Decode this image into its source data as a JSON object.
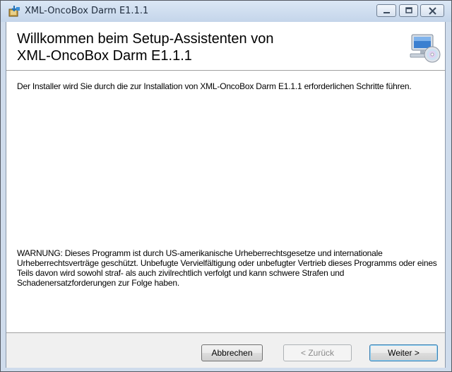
{
  "window": {
    "title": "XML-OncoBox Darm E1.1.1"
  },
  "header": {
    "title": "Willkommen beim Setup-Assistenten von\nXML-OncoBox Darm E1.1.1",
    "icon": "computer-cd-icon"
  },
  "body": {
    "intro": "Der Installer wird Sie durch die zur Installation von XML-OncoBox Darm E1.1.1 erforderlichen Schritte führen.",
    "warning": "WARNUNG: Dieses Programm ist durch US-amerikanische Urheberrechtsgesetze und internationale Urheberrechtsverträge geschützt. Unbefugte Vervielfältigung oder unbefugter Vertrieb dieses Programms oder eines Teils davon wird sowohl straf- als auch zivilrechtlich verfolgt und kann schwere Strafen und Schadenersatzforderungen zur Folge haben."
  },
  "buttons": {
    "cancel": "Abbrechen",
    "back": "< Zurück",
    "next": "Weiter >"
  }
}
